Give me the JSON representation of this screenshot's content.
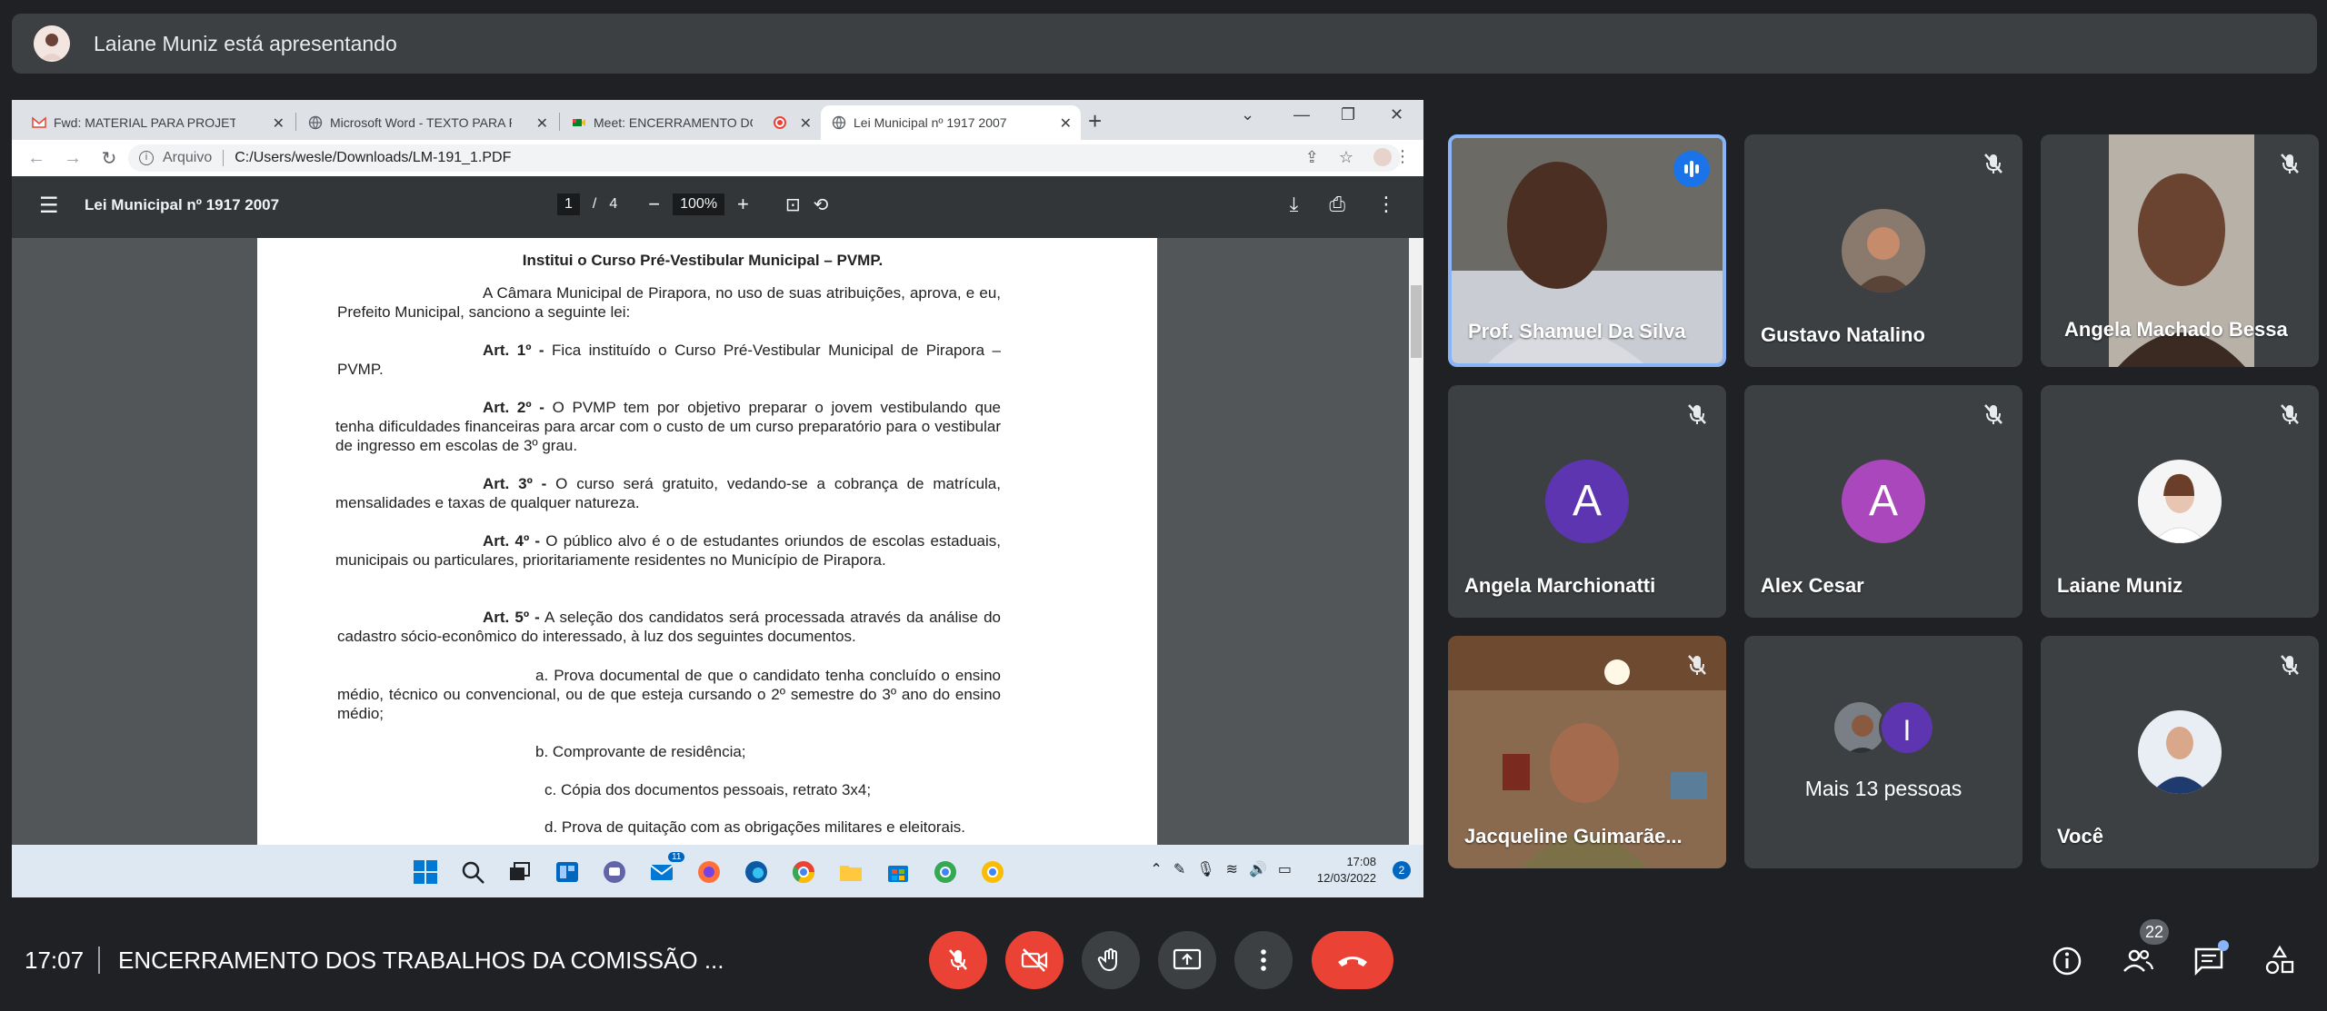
{
  "presenter": {
    "text": "Laiane Muniz está apresentando"
  },
  "browser": {
    "tabs": [
      {
        "title": "Fwd: MATERIAL PARA PROJETAR"
      },
      {
        "title": "Microsoft Word - TEXTO PARA RE"
      },
      {
        "title": "Meet: ENCERRAMENTO DOS"
      },
      {
        "title": "Lei Municipal nº 1917 2007"
      }
    ],
    "address_scheme": "Arquivo",
    "address_path": "C:/Users/wesle/Downloads/LM-191_1.PDF"
  },
  "pdf": {
    "title": "Lei Municipal nº 1917 2007",
    "page_current": "1",
    "page_sep": "/",
    "page_total": "4",
    "zoom": "100%",
    "heading": "Institui o Curso Pré-Vestibular Municipal – PVMP.",
    "intro": "A Câmara Municipal de Pirapora, no uso de suas atribuições, aprova, e eu, Prefeito Municipal, sanciono a seguinte lei:",
    "art1_label": "Art. 1º -",
    "art1_text": "Fica instituído o Curso Pré-Vestibular Municipal de Pirapora – PVMP.",
    "art2_label": "Art. 2º -",
    "art2_text": "O PVMP tem por objetivo preparar o jovem vestibulando que tenha dificuldades financeiras para arcar com o custo de um curso preparatório para o vestibular de ingresso em escolas de 3º grau.",
    "art3_label": "Art. 3º -",
    "art3_text": "O curso será gratuito, vedando-se a cobrança de matrícula, mensalidades e taxas de qualquer natureza.",
    "art4_label": "Art. 4º -",
    "art4_text": "O público alvo é o de estudantes oriundos de escolas estaduais, municipais ou particulares, prioritariamente residentes no Município de Pirapora.",
    "art5_label": "Art. 5º -",
    "art5_text": "A seleção dos candidatos será processada através da análise do cadastro sócio-econômico do interessado, à luz dos seguintes documentos.",
    "item_a": "a. Prova documental de que o candidato tenha concluído o ensino médio, técnico ou convencional, ou de que esteja cursando o 2º semestre do 3º ano do ensino médio;",
    "item_b": "b. Comprovante de residência;",
    "item_c": "c. Cópia dos documentos pessoais, retrato 3x4;",
    "item_d": "d. Prova de quitação com as obrigações militares e eleitorais."
  },
  "taskbar": {
    "time": "17:08",
    "date": "12/03/2022",
    "notif_count": "2",
    "mail_badge": "11"
  },
  "participants": [
    {
      "name": "Prof. Shamuel Da Silva"
    },
    {
      "name": "Gustavo Natalino"
    },
    {
      "name": "Angela Machado Bessa"
    },
    {
      "name": "Angela Marchionatti",
      "initial": "A"
    },
    {
      "name": "Alex Cesar",
      "initial": "A"
    },
    {
      "name": "Laiane Muniz"
    },
    {
      "name": "Jacqueline Guimarãe..."
    },
    {
      "name": "Mais 13 pessoas",
      "initial": "I"
    },
    {
      "name": "Você"
    }
  ],
  "meeting": {
    "clock": "17:07",
    "title": "ENCERRAMENTO DOS TRABALHOS DA COMISSÃO ...",
    "people_count": "22"
  },
  "colors": {
    "hangup": "#ea4335",
    "accent": "#1a73e8",
    "avatar_purple": "#5e35b1",
    "avatar_magenta": "#ab47bc"
  }
}
